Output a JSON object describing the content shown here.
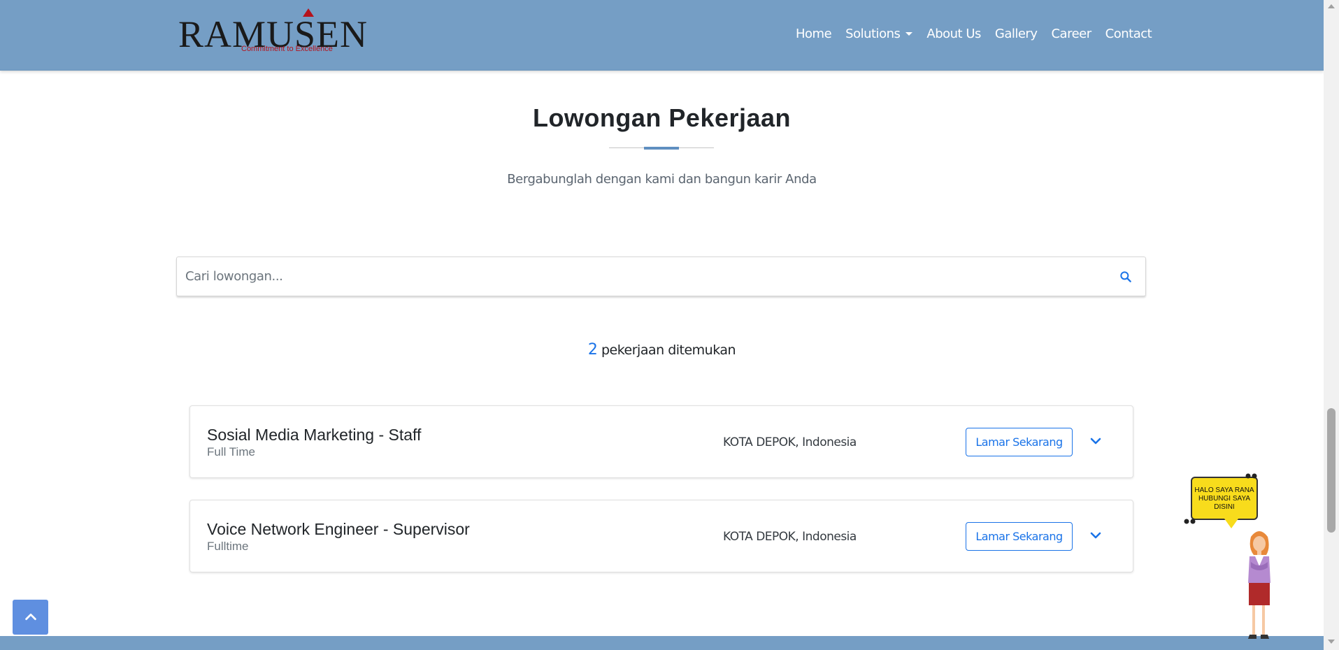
{
  "header": {
    "logo_text": "RAMUSEN",
    "logo_tagline": "Commitment to Excellence",
    "nav": [
      {
        "label": "Home"
      },
      {
        "label": "Solutions",
        "has_dropdown": true
      },
      {
        "label": "About Us"
      },
      {
        "label": "Gallery"
      },
      {
        "label": "Career"
      },
      {
        "label": "Contact"
      }
    ]
  },
  "section": {
    "title": "Lowongan Pekerjaan",
    "subtitle": "Bergabunglah dengan kami dan bangun karir Anda"
  },
  "search": {
    "placeholder": "Cari lowongan...",
    "value": ""
  },
  "results": {
    "count": "2",
    "label": "pekerjaan ditemukan"
  },
  "jobs": [
    {
      "title": "Sosial Media Marketing - Staff",
      "type": "Full Time",
      "location": "KOTA DEPOK, Indonesia",
      "apply_label": "Lamar Sekarang"
    },
    {
      "title": "Voice Network Engineer - Supervisor",
      "type": "Fulltime",
      "location": "KOTA DEPOK, Indonesia",
      "apply_label": "Lamar Sekarang"
    }
  ],
  "chat_widget": {
    "line1": "HALO SAYA RANA",
    "line2": "HUBUNGI SAYA",
    "line3": "DISINI"
  },
  "colors": {
    "header_bg": "#759ec5",
    "accent": "#1a73e8",
    "title_accent": "#5f8fc0",
    "to_top_bg": "#5f8fe0",
    "bubble_bg": "#f8dc1c"
  },
  "icons": {
    "search": "search-icon",
    "expand": "chevron-down-icon",
    "to_top": "chevron-up-icon",
    "dropdown": "caret-down-icon"
  }
}
